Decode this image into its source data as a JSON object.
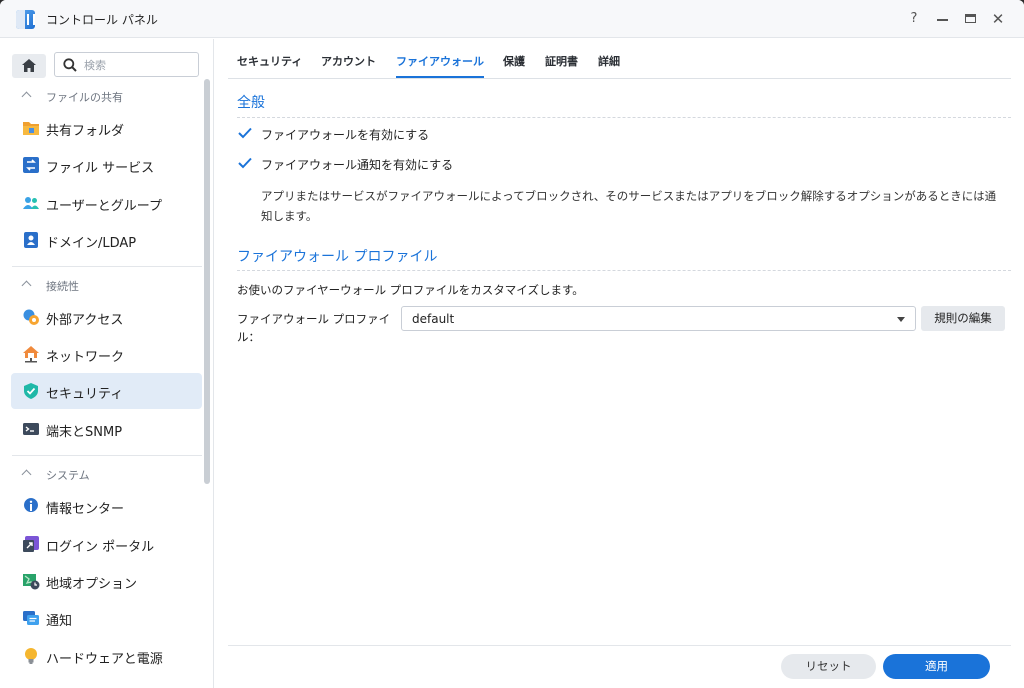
{
  "window": {
    "title": "コントロール パネル",
    "controls": {
      "help": "?",
      "close": "✕"
    }
  },
  "sidebar": {
    "search": {
      "placeholder": "検索"
    },
    "groups": [
      {
        "label": "ファイルの共有",
        "items": [
          "共有フォルダ",
          "ファイル サービス",
          "ユーザーとグループ",
          "ドメイン/LDAP"
        ]
      },
      {
        "label": "接続性",
        "items": [
          "外部アクセス",
          "ネットワーク",
          "セキュリティ",
          "端末とSNMP"
        ]
      },
      {
        "label": "システム",
        "items": [
          "情報センター",
          "ログイン ポータル",
          "地域オプション",
          "通知",
          "ハードウェアと電源"
        ]
      }
    ],
    "active_item": "セキュリティ"
  },
  "tabs": [
    "セキュリティ",
    "アカウント",
    "ファイアウォール",
    "保護",
    "証明書",
    "詳細"
  ],
  "active_tab": "ファイアウォール",
  "general": {
    "title": "全般",
    "enable_firewall": {
      "label": "ファイアウォールを有効にする",
      "checked": true
    },
    "enable_notification": {
      "label": "ファイアウォール通知を有効にする",
      "checked": true
    },
    "description": "アプリまたはサービスがファイアウォールによってブロックされ、そのサービスまたはアプリをブロック解除するオプションがあるときには通知します。"
  },
  "profile": {
    "title": "ファイアウォール プロファイル",
    "intro": "お使いのファイヤーウォール プロファイルをカスタマイズします。",
    "field_label": "ファイアウォール プロファイル：",
    "selected": "default",
    "edit_rules_label": "規則の編集"
  },
  "footer": {
    "reset_label": "リセット",
    "apply_label": "適用"
  },
  "colors": {
    "accent": "#1a73d9",
    "active_bg": "#e1ebf7"
  }
}
